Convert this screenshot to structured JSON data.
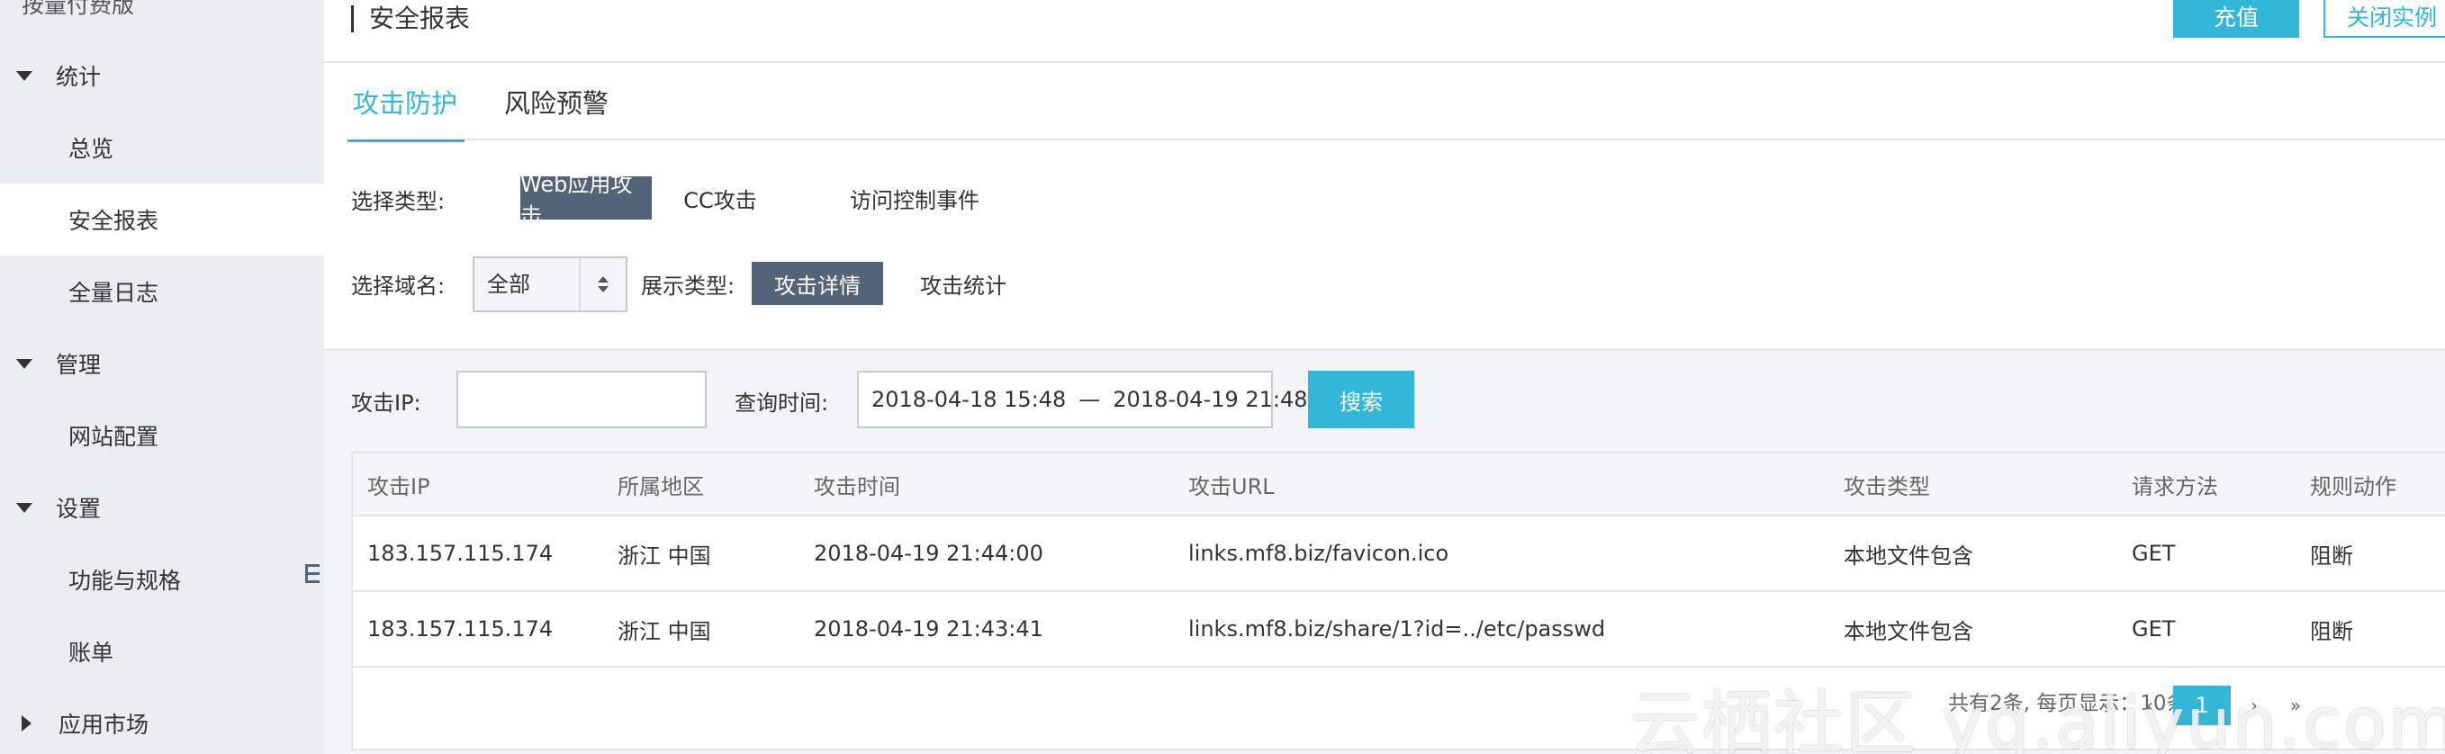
{
  "sidebar": {
    "top_item": "按量付费版",
    "groups": [
      {
        "label": "统计",
        "items": [
          "总览",
          "安全报表",
          "全量日志"
        ]
      },
      {
        "label": "管理",
        "items": [
          "网站配置"
        ]
      },
      {
        "label": "设置",
        "items": [
          "功能与规格",
          "账单"
        ]
      },
      {
        "label": "应用市场",
        "items": []
      }
    ]
  },
  "header": {
    "title": "安全报表",
    "recharge_label": "充值",
    "close_instance_label": "关闭实例"
  },
  "tabs": [
    "攻击防护",
    "风险预警"
  ],
  "filters": {
    "type_label": "选择类型:",
    "type_options": [
      "Web应用攻击",
      "CC攻击",
      "访问控制事件"
    ],
    "domain_label": "选择域名:",
    "domain_value": "全部",
    "display_label": "展示类型:",
    "display_options": [
      "攻击详情",
      "攻击统计"
    ]
  },
  "search": {
    "ip_label": "攻击IP:",
    "ip_value": "",
    "time_label": "查询时间:",
    "time_start": "2018-04-18 15:48",
    "time_sep": "—",
    "time_end": "2018-04-19 21:48",
    "search_label": "搜索"
  },
  "table": {
    "headers": [
      "攻击IP",
      "所属地区",
      "攻击时间",
      "攻击URL",
      "攻击类型",
      "请求方法",
      "规则动作"
    ],
    "rows": [
      [
        "183.157.115.174",
        "浙江 中国",
        "2018-04-19 21:44:00",
        "links.mf8.biz/favicon.ico",
        "本地文件包含",
        "GET",
        "阻断"
      ],
      [
        "183.157.115.174",
        "浙江 中国",
        "2018-04-19 21:43:41",
        "links.mf8.biz/share/1?id=../etc/passwd",
        "本地文件包含",
        "GET",
        "阻断"
      ]
    ]
  },
  "pagination": {
    "info": "共有2条, 每页显示：10条",
    "first": "«",
    "prev": "‹",
    "current_page": "1",
    "next": "›",
    "last": "»"
  },
  "watermark": "云栖社区 yq.aliyun.com",
  "colors": {
    "accent": "#33b7d9",
    "segment_active": "#546478",
    "sidebar_bg": "#eaedf1"
  }
}
